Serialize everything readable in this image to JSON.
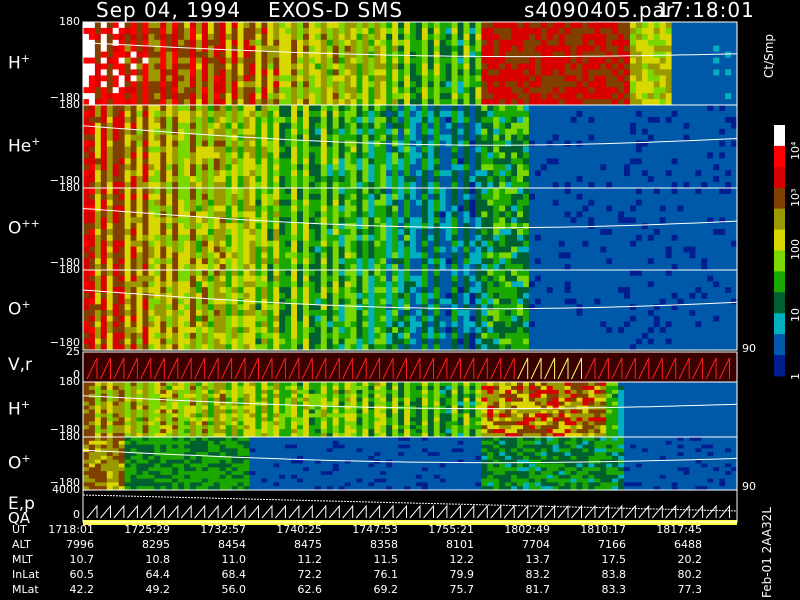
{
  "header": {
    "date": "Sep 04, 1994",
    "instrument": "EXOS-D SMS",
    "file": "s4090405.par",
    "time": "17:18:01"
  },
  "colorbar": {
    "label": "Ct/Smp",
    "ticks": [
      "10⁴",
      "10³",
      "100",
      "10",
      "1"
    ],
    "colors": [
      "#ffffff",
      "#ff0000",
      "#d80000",
      "#804000",
      "#9a9a00",
      "#d8d800",
      "#7ad800",
      "#1aa800",
      "#006030",
      "#00b0c0",
      "#0058a8",
      "#001e90"
    ]
  },
  "panels": [
    {
      "label": "H",
      "sup": "+",
      "ymax": "180",
      "ymin": "−180"
    },
    {
      "label": "He",
      "sup": "+",
      "ymax": "180",
      "ymin": "−180"
    },
    {
      "label": "O",
      "sup": "++",
      "ymax": "180",
      "ymin": "−180"
    },
    {
      "label": "O",
      "sup": "+",
      "ymax": "180",
      "ymin": "−180"
    },
    {
      "label": "V,r",
      "sup": "",
      "ymax": "25",
      "ymin": "0"
    },
    {
      "label": "H",
      "sup": "+",
      "ymax": "180",
      "ymin": "−180"
    },
    {
      "label": "O",
      "sup": "+",
      "ymax": "180",
      "ymin": "−180"
    },
    {
      "label": "E,p",
      "sup": "",
      "ymax": "4000",
      "ymin": "0"
    }
  ],
  "qa_label": "QA",
  "right_labels": [
    "90",
    "90"
  ],
  "side_text": "Feb-01 2AA32L",
  "table": {
    "headers": [
      "UT",
      "ALT",
      "MLT",
      "InLat",
      "MLat"
    ],
    "rows": [
      [
        "1718:01",
        "1725:29",
        "1732:57",
        "1740:25",
        "1747:53",
        "1755:21",
        "1802:49",
        "1810:17",
        "1817:45"
      ],
      [
        "7996",
        "8295",
        "8454",
        "8475",
        "8358",
        "8101",
        "7704",
        "7166",
        "6488"
      ],
      [
        "10.7",
        "10.8",
        "11.0",
        "11.2",
        "11.5",
        "12.2",
        "13.7",
        "17.5",
        "20.2"
      ],
      [
        "60.5",
        "64.4",
        "68.4",
        "72.2",
        "76.1",
        "79.9",
        "83.2",
        "83.8",
        "80.2"
      ],
      [
        "42.2",
        "49.2",
        "56.0",
        "62.6",
        "69.2",
        "75.7",
        "81.7",
        "83.3",
        "77.3"
      ]
    ]
  },
  "chart_data": {
    "type": "heatmap",
    "title": "Sep 04, 1994   EXOS-D SMS",
    "x": [
      "1718:01",
      "1725:29",
      "1732:57",
      "1740:25",
      "1747:53",
      "1755:21",
      "1802:49",
      "1810:17",
      "1817:45"
    ],
    "color_scale": "log",
    "color_range": [
      1,
      10000
    ],
    "color_label": "Ct/Smp",
    "series": [
      {
        "name": "H+",
        "y_range": [
          -180,
          180
        ]
      },
      {
        "name": "He+",
        "y_range": [
          -180,
          180
        ]
      },
      {
        "name": "O++",
        "y_range": [
          -180,
          180
        ]
      },
      {
        "name": "O+",
        "y_range": [
          -180,
          180
        ]
      },
      {
        "name": "V,r",
        "y_range": [
          0,
          25
        ]
      },
      {
        "name": "H+",
        "y_range": [
          -180,
          180
        ]
      },
      {
        "name": "O+",
        "y_range": [
          -180,
          180
        ]
      },
      {
        "name": "E,p",
        "y_range": [
          0,
          4000
        ]
      }
    ]
  }
}
